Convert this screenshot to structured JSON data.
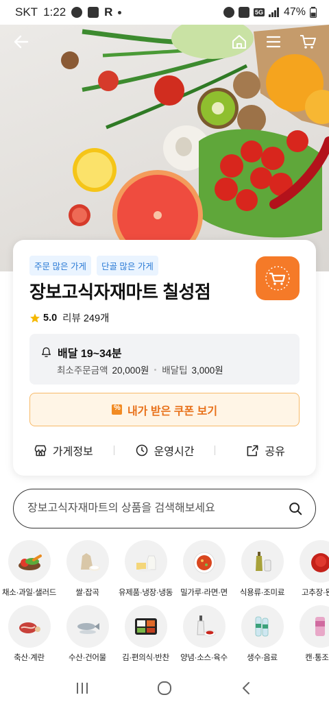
{
  "status_bar": {
    "carrier": "SKT",
    "time": "1:22",
    "network": "5G",
    "battery": "47%"
  },
  "store": {
    "tags": [
      "주문 많은 가게",
      "단골 많은 가게"
    ],
    "name": "장보고식자재마트 칠성점",
    "rating": "5.0",
    "review_label": "리뷰",
    "review_count": "249개",
    "delivery_title": "배달 19~34분",
    "min_order_label": "최소주문금액",
    "min_order_value": "20,000원",
    "delivery_tip_label": "배달팁",
    "delivery_tip_value": "3,000원",
    "coupon_button": "내가 받은 쿠폰 보기",
    "actions": {
      "info": "가게정보",
      "hours": "운영시간",
      "share": "공유"
    }
  },
  "search": {
    "placeholder": "장보고식자재마트의 상품을 검색해보세요"
  },
  "categories_row1": [
    {
      "label": "채소·과일·샐러드",
      "icon": "vegetables-icon"
    },
    {
      "label": "쌀·잡곡",
      "icon": "rice-sack-icon"
    },
    {
      "label": "유제품·냉장·냉동",
      "icon": "dairy-icon"
    },
    {
      "label": "밀가루·라면·면",
      "icon": "noodles-icon"
    },
    {
      "label": "식용류·조미료",
      "icon": "oil-bottle-icon"
    },
    {
      "label": "고추장·된장",
      "icon": "paste-icon"
    }
  ],
  "categories_row2": [
    {
      "label": "축산·계란",
      "icon": "meat-icon"
    },
    {
      "label": "수산·건어물",
      "icon": "fish-icon"
    },
    {
      "label": "김·편의식·반찬",
      "icon": "lunchbox-icon"
    },
    {
      "label": "양념·소스·육수",
      "icon": "sauce-icon"
    },
    {
      "label": "생수·음료",
      "icon": "water-bottle-icon"
    },
    {
      "label": "캔·통조림",
      "icon": "can-icon"
    }
  ],
  "colors": {
    "accent_orange": "#f57a28",
    "tag_blue": "#2a7ad5",
    "tag_bg": "#eaf4ff",
    "star": "#f5b800"
  }
}
